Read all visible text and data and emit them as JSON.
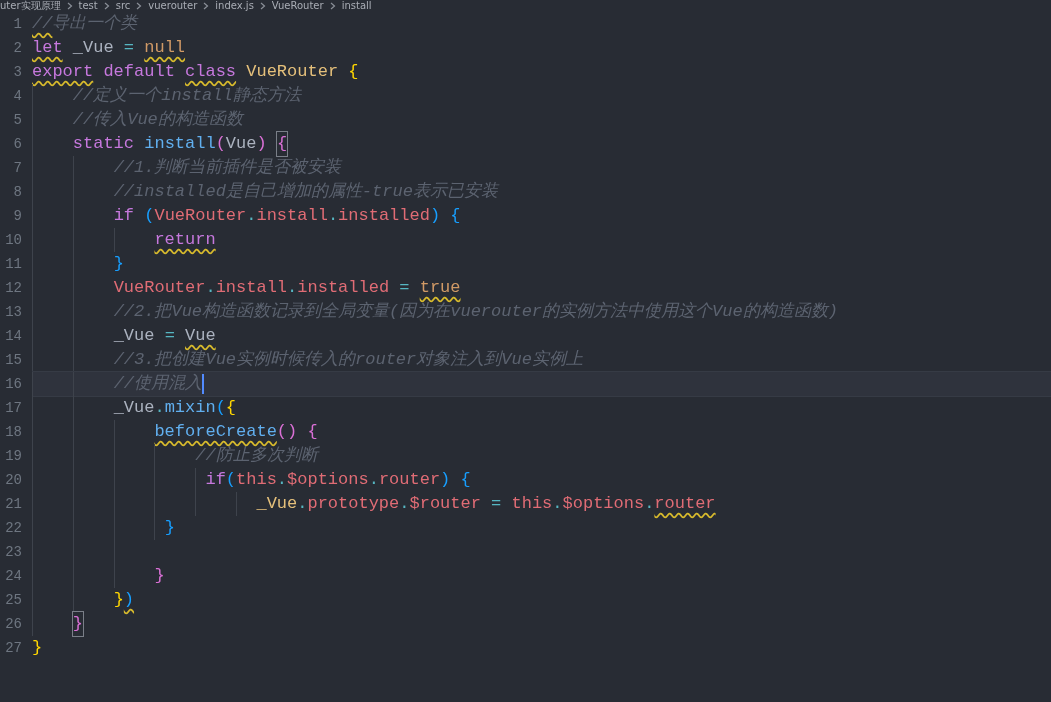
{
  "breadcrumb": [
    "uter实现原理",
    "test",
    "src",
    "vuerouter",
    "index.js",
    "VueRouter",
    "install"
  ],
  "lines": [
    {
      "number": "1",
      "tokens": [
        {
          "text": "//",
          "kind": "comment",
          "warn": true
        },
        {
          "text": "导出一个类",
          "kind": "comment"
        }
      ]
    },
    {
      "number": "2",
      "tokens": [
        {
          "text": "let",
          "kind": "keyword",
          "warn": true
        },
        {
          "text": " _Vue ",
          "kind": "plain"
        },
        {
          "text": "= ",
          "kind": "operator"
        },
        {
          "text": "null",
          "kind": "constant",
          "warn": true
        }
      ]
    },
    {
      "number": "3",
      "tokens": [
        {
          "text": "export",
          "kind": "keyword",
          "warn": true
        },
        {
          "text": " default ",
          "kind": "keyword"
        },
        {
          "text": "class",
          "kind": "keyword",
          "warn": true
        },
        {
          "text": " VueRouter ",
          "kind": "class"
        },
        {
          "text": "{",
          "kind": "bracket1"
        }
      ]
    },
    {
      "number": "4",
      "tokens": [
        {
          "text": "    //定义一个install静态方法",
          "kind": "comment"
        }
      ]
    },
    {
      "number": "5",
      "tokens": [
        {
          "text": "    //传入Vue的构造函数",
          "kind": "comment"
        }
      ]
    },
    {
      "number": "6",
      "tokens": [
        {
          "text": "    static ",
          "kind": "keyword"
        },
        {
          "text": "install",
          "kind": "function"
        },
        {
          "text": "(",
          "kind": "bracket2"
        },
        {
          "text": "Vue",
          "kind": "plain"
        },
        {
          "text": ") ",
          "kind": "bracket2"
        },
        {
          "text": "{",
          "kind": "bracket2",
          "matched": true
        }
      ]
    },
    {
      "number": "7",
      "tokens": [
        {
          "text": "        //1.判断当前插件是否被安装",
          "kind": "comment"
        }
      ]
    },
    {
      "number": "8",
      "tokens": [
        {
          "text": "        //installed是自己增加的属性-true表示已安装",
          "kind": "comment"
        }
      ]
    },
    {
      "number": "9",
      "tokens": [
        {
          "text": "        if ",
          "kind": "keyword"
        },
        {
          "text": "(",
          "kind": "bracket3"
        },
        {
          "text": "VueRouter",
          "kind": "property"
        },
        {
          "text": ".",
          "kind": "operator"
        },
        {
          "text": "install",
          "kind": "property"
        },
        {
          "text": ".",
          "kind": "operator"
        },
        {
          "text": "installed",
          "kind": "property"
        },
        {
          "text": ") ",
          "kind": "bracket3"
        },
        {
          "text": "{",
          "kind": "bracket3"
        }
      ]
    },
    {
      "number": "10",
      "tokens": [
        {
          "text": "            return",
          "kind": "keyword",
          "warn": true
        }
      ]
    },
    {
      "number": "11",
      "tokens": [
        {
          "text": "        }",
          "kind": "bracket3"
        }
      ]
    },
    {
      "number": "12",
      "tokens": [
        {
          "text": "        VueRouter",
          "kind": "property"
        },
        {
          "text": ".",
          "kind": "operator"
        },
        {
          "text": "install",
          "kind": "property"
        },
        {
          "text": ".",
          "kind": "operator"
        },
        {
          "text": "installed ",
          "kind": "property"
        },
        {
          "text": "= ",
          "kind": "operator"
        },
        {
          "text": "true",
          "kind": "constant",
          "warn": true
        }
      ]
    },
    {
      "number": "13",
      "tokens": [
        {
          "text": "        //2.把Vue构造函数记录到全局变量(因为在vuerouter的实例方法中使用这个Vue的构造函数)",
          "kind": "comment"
        }
      ]
    },
    {
      "number": "14",
      "tokens": [
        {
          "text": "        _Vue ",
          "kind": "plain"
        },
        {
          "text": "= ",
          "kind": "operator"
        },
        {
          "text": "Vue",
          "kind": "plain",
          "warn": true
        }
      ]
    },
    {
      "number": "15",
      "tokens": [
        {
          "text": "        //3.把创建Vue实例时候传入的router对象注入到Vue实例上",
          "kind": "comment"
        }
      ]
    },
    {
      "number": "16",
      "current": true,
      "tokens": [
        {
          "text": "        //使用混入",
          "kind": "comment"
        }
      ]
    },
    {
      "number": "17",
      "tokens": [
        {
          "text": "        _Vue",
          "kind": "plain"
        },
        {
          "text": ".",
          "kind": "operator"
        },
        {
          "text": "mixin",
          "kind": "function"
        },
        {
          "text": "(",
          "kind": "bracket3"
        },
        {
          "text": "{",
          "kind": "bracket1"
        }
      ]
    },
    {
      "number": "18",
      "tokens": [
        {
          "text": "            beforeCreate",
          "kind": "function",
          "warn": true
        },
        {
          "text": "() ",
          "kind": "bracket2"
        },
        {
          "text": "{",
          "kind": "bracket2"
        }
      ]
    },
    {
      "number": "19",
      "tokens": [
        {
          "text": "                //防止多次判断",
          "kind": "comment"
        }
      ]
    },
    {
      "number": "20",
      "tokens": [
        {
          "text": "                 if",
          "kind": "keyword"
        },
        {
          "text": "(",
          "kind": "bracket3"
        },
        {
          "text": "this",
          "kind": "property"
        },
        {
          "text": ".",
          "kind": "operator"
        },
        {
          "text": "$options",
          "kind": "property"
        },
        {
          "text": ".",
          "kind": "operator"
        },
        {
          "text": "router",
          "kind": "property"
        },
        {
          "text": ") ",
          "kind": "bracket3"
        },
        {
          "text": "{",
          "kind": "bracket3"
        }
      ]
    },
    {
      "number": "21",
      "tokens": [
        {
          "text": "                      _Vue",
          "kind": "class"
        },
        {
          "text": ".",
          "kind": "operator"
        },
        {
          "text": "prototype",
          "kind": "property"
        },
        {
          "text": ".",
          "kind": "operator"
        },
        {
          "text": "$router ",
          "kind": "property"
        },
        {
          "text": "= ",
          "kind": "operator"
        },
        {
          "text": "this",
          "kind": "property"
        },
        {
          "text": ".",
          "kind": "operator"
        },
        {
          "text": "$options",
          "kind": "property"
        },
        {
          "text": ".",
          "kind": "operator"
        },
        {
          "text": "router",
          "kind": "property",
          "warn": true
        }
      ]
    },
    {
      "number": "22",
      "tokens": [
        {
          "text": "             }",
          "kind": "bracket3"
        }
      ]
    },
    {
      "number": "23"
    },
    {
      "number": "24",
      "tokens": [
        {
          "text": "            }",
          "kind": "bracket2"
        }
      ]
    },
    {
      "number": "25",
      "tokens": [
        {
          "text": "        }",
          "kind": "bracket1"
        },
        {
          "text": ")",
          "kind": "bracket3",
          "warn": true
        }
      ]
    },
    {
      "number": "26",
      "tokens": [
        {
          "text": "    }",
          "kind": "bracket2",
          "matched": true
        }
      ]
    },
    {
      "number": "27",
      "tokens": [
        {
          "text": "}",
          "kind": "bracket1"
        }
      ]
    }
  ]
}
